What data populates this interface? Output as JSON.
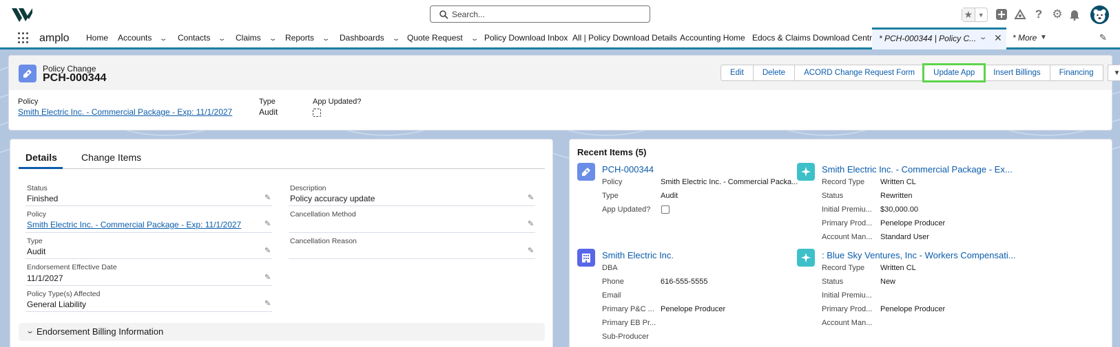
{
  "header": {
    "search_placeholder": "Search...",
    "icons": [
      "star-icon",
      "add-icon",
      "trailhead-icon",
      "help-icon",
      "setup-gear-icon",
      "bell-icon",
      "user-avatar"
    ]
  },
  "nav": {
    "app_name": "amplo",
    "items": [
      {
        "label": "Home",
        "has_menu": false
      },
      {
        "label": "Accounts",
        "has_menu": true
      },
      {
        "label": "Contacts",
        "has_menu": true
      },
      {
        "label": "Claims",
        "has_menu": true
      },
      {
        "label": "Reports",
        "has_menu": true
      },
      {
        "label": "Dashboards",
        "has_menu": true
      },
      {
        "label": "Quote Request",
        "has_menu": true
      },
      {
        "label": "Policy Download Inbox",
        "has_menu": false
      },
      {
        "label": "All | Policy Download Details",
        "has_menu": false
      },
      {
        "label": "Accounting Home",
        "has_menu": false
      },
      {
        "label": "Edocs & Claims Download Central",
        "has_menu": false
      }
    ],
    "active_tab": "* PCH-000344 | Policy C...",
    "more": "* More"
  },
  "record": {
    "object_label": "Policy Change",
    "name": "PCH-000344",
    "buttons": [
      "Edit",
      "Delete",
      "ACORD Change Request Form",
      "Update App",
      "Insert Billings",
      "Financing"
    ],
    "highlighted_button": "Update App",
    "highlights": {
      "policy_label": "Policy",
      "policy_value": "Smith Electric Inc. - Commercial Package - Exp: 11/1/2027",
      "type_label": "Type",
      "type_value": "Audit",
      "app_updated_label": "App Updated?"
    }
  },
  "details": {
    "tabs": [
      "Details",
      "Change Items"
    ],
    "left_fields": [
      {
        "label": "Status",
        "value": "Finished",
        "link": false
      },
      {
        "label": "Policy",
        "value": "Smith Electric Inc. - Commercial Package - Exp: 11/1/2027",
        "link": true
      },
      {
        "label": "Type",
        "value": "Audit",
        "link": false
      },
      {
        "label": "Endorsement Effective Date",
        "value": "11/1/2027",
        "link": false
      },
      {
        "label": "Policy Type(s) Affected",
        "value": "General Liability",
        "link": false
      }
    ],
    "right_fields": [
      {
        "label": "Description",
        "value": "Policy accuracy update"
      },
      {
        "label": "Cancellation Method",
        "value": ""
      },
      {
        "label": "Cancellation Reason",
        "value": ""
      }
    ],
    "section_title": "Endorsement Billing Information"
  },
  "recent": {
    "title": "Recent Items (5)",
    "items": [
      {
        "title": "PCH-000344",
        "icon": "policy-change-icon",
        "rows": [
          {
            "label": "Policy",
            "value": "Smith Electric Inc. - Commercial Packa..."
          },
          {
            "label": "Type",
            "value": "Audit"
          },
          {
            "label": "App Updated?",
            "value": ""
          }
        ]
      },
      {
        "title": "Smith Electric Inc. - Commercial Package - Ex...",
        "icon": "policy-icon",
        "rows": [
          {
            "label": "Record Type",
            "value": "Written CL"
          },
          {
            "label": "Status",
            "value": "Rewritten"
          },
          {
            "label": "Initial Premiu...",
            "value": "$30,000.00"
          },
          {
            "label": "Primary Prod...",
            "value": "Penelope Producer"
          },
          {
            "label": "Account Man...",
            "value": "Standard User"
          }
        ]
      },
      {
        "title": "Smith Electric Inc.",
        "icon": "account-icon",
        "rows": [
          {
            "label": "DBA",
            "value": ""
          },
          {
            "label": "Phone",
            "value": "616-555-5555"
          },
          {
            "label": "Email",
            "value": ""
          },
          {
            "label": "Primary P&C ...",
            "value": "Penelope Producer"
          },
          {
            "label": "Primary EB Pr...",
            "value": ""
          },
          {
            "label": "Sub-Producer",
            "value": ""
          }
        ]
      },
      {
        "title": ": Blue Sky Ventures, Inc - Workers Compensati...",
        "icon": "policy-icon",
        "rows": [
          {
            "label": "Record Type",
            "value": "Written CL"
          },
          {
            "label": "Status",
            "value": "New"
          },
          {
            "label": "Initial Premiu...",
            "value": ""
          },
          {
            "label": "Primary Prod...",
            "value": "Penelope Producer"
          },
          {
            "label": "Account Man...",
            "value": ""
          }
        ]
      }
    ]
  },
  "colors": {
    "accent": "#0b5cab",
    "nav_border": "#1b7fa1",
    "highlight": "#5dd44c",
    "policy_icon": "#3ec0c9",
    "policy_change_icon": "#6a8de8",
    "account_icon": "#5867e8"
  }
}
